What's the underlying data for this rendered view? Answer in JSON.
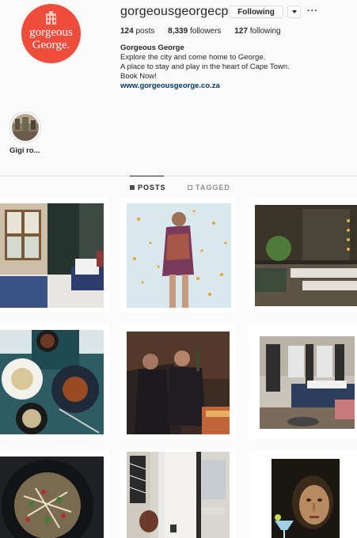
{
  "profile": {
    "avatar_line1": "gorgeous",
    "avatar_line2": "George.",
    "username": "gorgeousgeorgecpt",
    "follow_label": "Following",
    "more_label": "···",
    "stats": {
      "posts_count": "124",
      "posts_label": "posts",
      "followers_count": "8,339",
      "followers_label": "followers",
      "following_count": "127",
      "following_label": "following"
    },
    "bio": {
      "name": "Gorgeous George",
      "line1": "Explore the city and come home to George.",
      "line2": "A place to stay and play in the heart of Cape Town.",
      "line3": "Book Now!",
      "link": "www.gorgeousgeorge.co.za"
    },
    "brand_color": "#ee4d3c"
  },
  "highlights": [
    {
      "label": "Gigi ro..."
    }
  ],
  "tabs": {
    "posts": "POSTS",
    "tagged": "TAGGED"
  },
  "posts": [
    {
      "icon": "hotel-bedroom-window-photo"
    },
    {
      "icon": "woman-confetti-photo"
    },
    {
      "icon": "restaurant-interior-photo"
    },
    {
      "icon": "food-plates-photo"
    },
    {
      "icon": "women-robes-champagne-photo"
    },
    {
      "icon": "modern-bedroom-photo"
    },
    {
      "icon": "salad-bowl-photo"
    },
    {
      "icon": "bathroom-doorway-photo"
    },
    {
      "icon": "renaissance-portrait-cocktail-photo"
    }
  ]
}
